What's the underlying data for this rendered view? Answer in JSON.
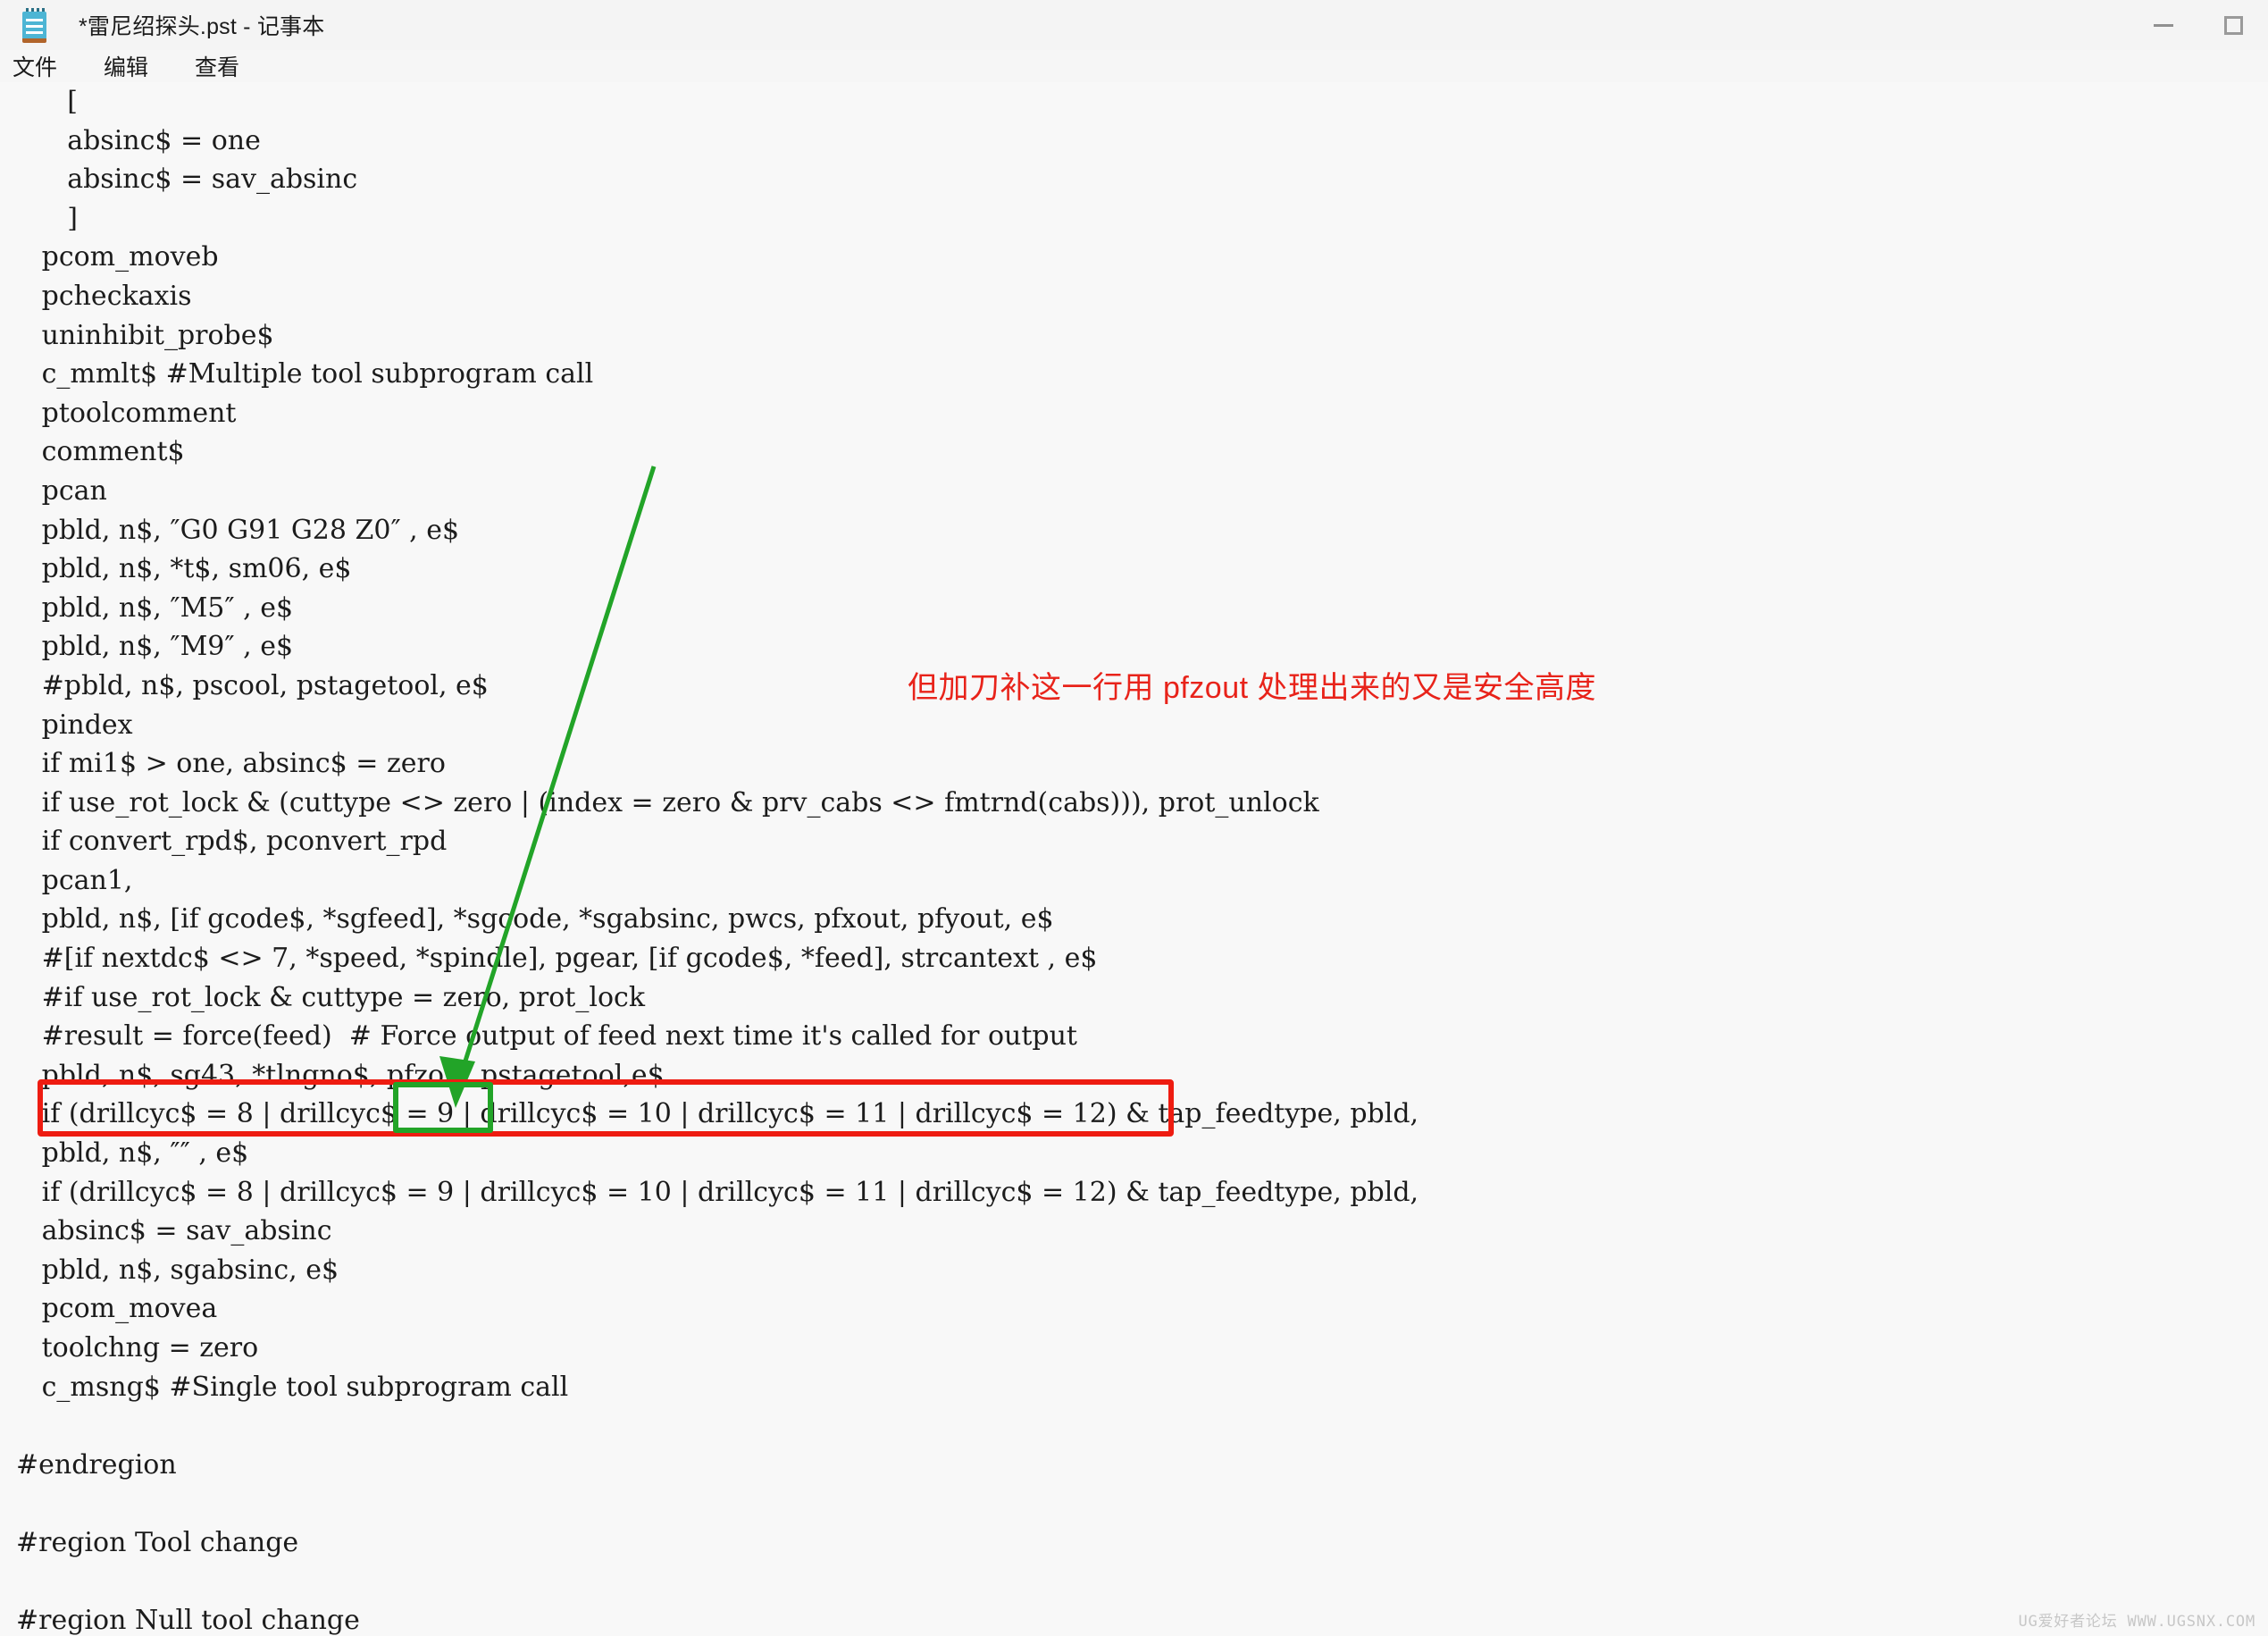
{
  "window": {
    "title": "*雷尼绍探头.pst - 记事本",
    "icon": "notepad-icon",
    "controls": {
      "minimize": "minimize-icon",
      "maximize": "maximize-icon"
    }
  },
  "menubar": {
    "items": [
      {
        "label": "文件",
        "name": "menu-file"
      },
      {
        "label": "编辑",
        "name": "menu-edit"
      },
      {
        "label": "查看",
        "name": "menu-view"
      }
    ]
  },
  "editor": {
    "lines": [
      "      [",
      "      absinc$ = one",
      "      absinc$ = sav_absinc",
      "      ]",
      "   pcom_moveb",
      "   pcheckaxis",
      "   uninhibit_probe$",
      "   c_mmlt$ #Multiple tool subprogram call",
      "   ptoolcomment",
      "   comment$",
      "   pcan",
      "   pbld, n$, ″G0 G91 G28 Z0″ , e$",
      "   pbld, n$, *t$, sm06, e$",
      "   pbld, n$, ″M5″ , e$",
      "   pbld, n$, ″M9″ , e$",
      "   #pbld, n$, pscool, pstagetool, e$",
      "   pindex",
      "   if mi1$ > one, absinc$ = zero",
      "   if use_rot_lock & (cuttype <> zero | (index = zero & prv_cabs <> fmtrnd(cabs))), prot_unlock",
      "   if convert_rpd$, pconvert_rpd",
      "   pcan1,",
      "   pbld, n$, [if gcode$, *sgfeed], *sgcode, *sgabsinc, pwcs, pfxout, pfyout, e$",
      "   #[if nextdc$ <> 7, *speed, *spindle], pgear, [if gcode$, *feed], strcantext , e$",
      "   #if use_rot_lock & cuttype = zero, prot_lock",
      "   #result = force(feed)  # Force output of feed next time it's called for output",
      "   pbld, n$, sg43, *tlngno$, pfzout,pstagetool,e$",
      "   if (drillcyc$ = 8 | drillcyc$ = 9 | drillcyc$ = 10 | drillcyc$ = 11 | drillcyc$ = 12) & tap_feedtype, pbld,",
      "   pbld, n$, ″″ , e$",
      "   if (drillcyc$ = 8 | drillcyc$ = 9 | drillcyc$ = 10 | drillcyc$ = 11 | drillcyc$ = 12) & tap_feedtype, pbld,",
      "   absinc$ = sav_absinc",
      "   pbld, n$, sgabsinc, e$",
      "   pcom_movea",
      "   toolchng = zero",
      "   c_msng$ #Single tool subprogram call",
      "",
      "#endregion",
      "",
      "#region Tool change",
      "",
      "#region Null tool change"
    ]
  },
  "annotations": {
    "note_text": "但加刀补这一行用 pfzout 处理出来的又是安全高度",
    "note_color": "#e8231a",
    "highlight_line_text": "pbld, n$, sg43, *tlngno$, pfzout,pstagetool,e$",
    "highlight_box_color": "#ee1c11",
    "highlight_token": "pfzout,",
    "token_box_color": "#22a428",
    "arrow_color": "#22a428"
  },
  "watermark": {
    "text": "UG爱好者论坛 WWW.UGSNX.COM"
  }
}
